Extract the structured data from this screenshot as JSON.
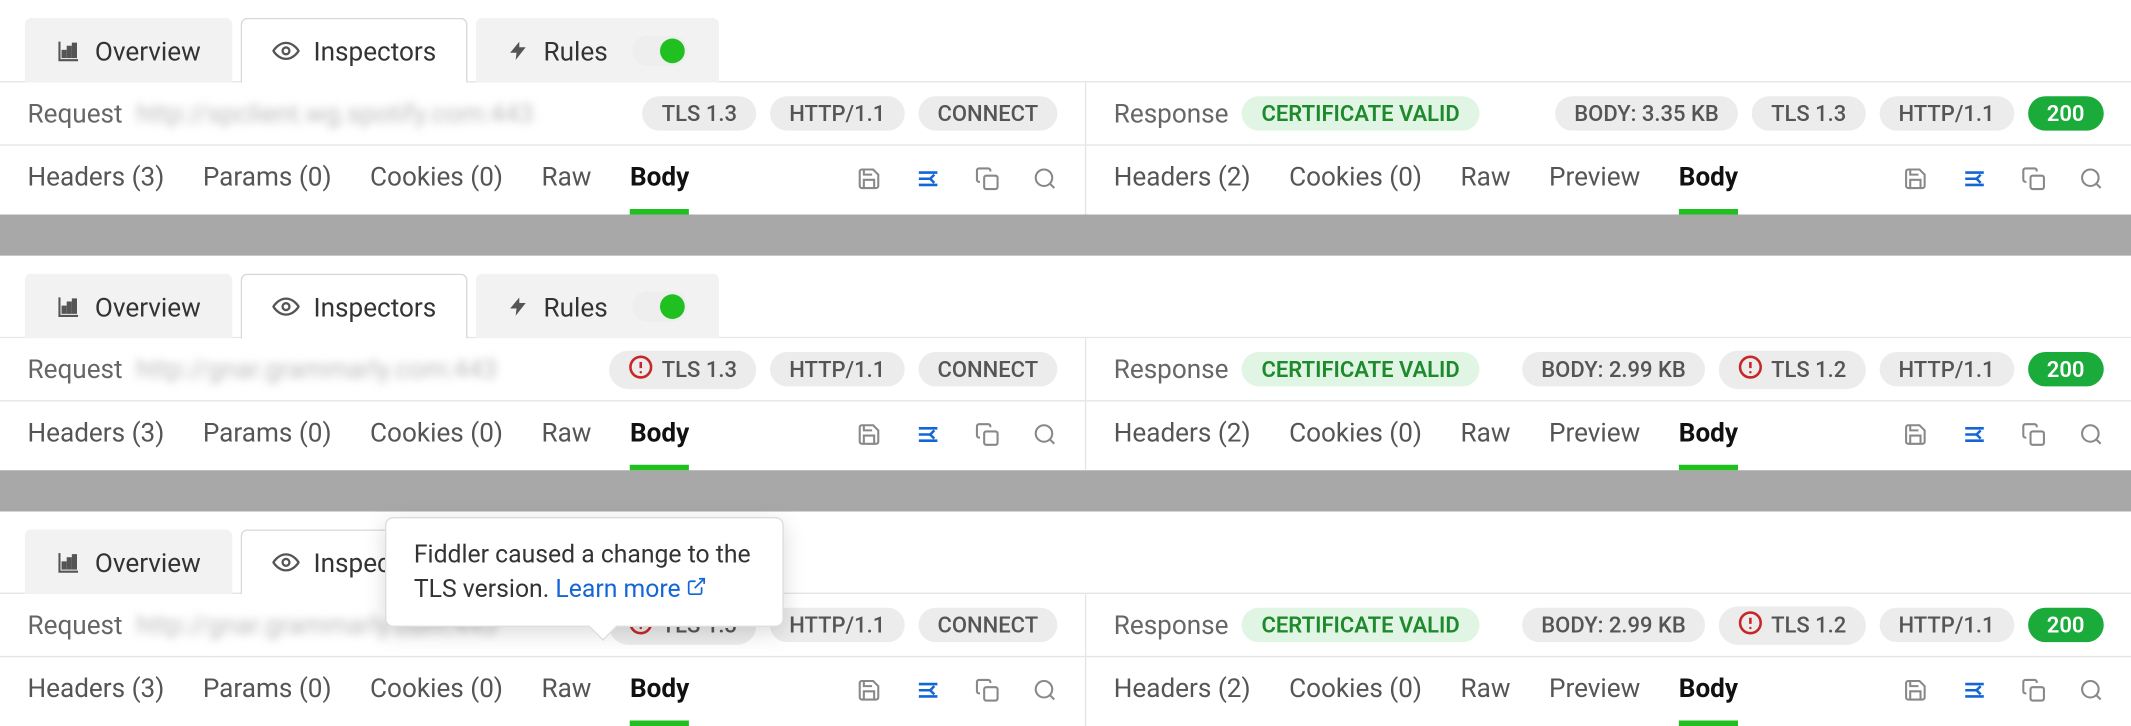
{
  "tabs": {
    "overview": "Overview",
    "inspectors": "Inspectors",
    "rules": "Rules"
  },
  "panels": [
    {
      "request": {
        "label": "Request",
        "host": "http://spclient.wg.spotify.com:443",
        "pills": [
          {
            "text": "TLS 1.3",
            "warn": false
          },
          {
            "text": "HTTP/1.1"
          },
          {
            "text": "CONNECT"
          }
        ],
        "subtabs": [
          {
            "label": "Headers",
            "count": 3
          },
          {
            "label": "Params",
            "count": 0
          },
          {
            "label": "Cookies",
            "count": 0
          },
          {
            "label_only": "Raw"
          },
          {
            "label_only": "Body",
            "active": true
          }
        ]
      },
      "response": {
        "label": "Response",
        "cert": "CERTIFICATE VALID",
        "pills": [
          {
            "text": "BODY: 3.35 KB"
          },
          {
            "text": "TLS 1.3",
            "warn": false
          },
          {
            "text": "HTTP/1.1"
          }
        ],
        "status": "200",
        "subtabs": [
          {
            "label": "Headers",
            "count": 2
          },
          {
            "label": "Cookies",
            "count": 0
          },
          {
            "label_only": "Raw"
          },
          {
            "label_only": "Preview"
          },
          {
            "label_only": "Body",
            "active": true
          }
        ]
      }
    },
    {
      "request": {
        "label": "Request",
        "host": "http://gnar.grammarly.com:443",
        "pills": [
          {
            "text": "TLS 1.3",
            "warn": true
          },
          {
            "text": "HTTP/1.1"
          },
          {
            "text": "CONNECT"
          }
        ],
        "subtabs": [
          {
            "label": "Headers",
            "count": 3
          },
          {
            "label": "Params",
            "count": 0
          },
          {
            "label": "Cookies",
            "count": 0
          },
          {
            "label_only": "Raw"
          },
          {
            "label_only": "Body",
            "active": true
          }
        ]
      },
      "response": {
        "label": "Response",
        "cert": "CERTIFICATE VALID",
        "pills": [
          {
            "text": "BODY: 2.99 KB"
          },
          {
            "text": "TLS 1.2",
            "warn": true
          },
          {
            "text": "HTTP/1.1"
          }
        ],
        "status": "200",
        "subtabs": [
          {
            "label": "Headers",
            "count": 2
          },
          {
            "label": "Cookies",
            "count": 0
          },
          {
            "label_only": "Raw"
          },
          {
            "label_only": "Preview"
          },
          {
            "label_only": "Body",
            "active": true
          }
        ]
      }
    },
    {
      "tooltip": {
        "text": "Fiddler caused a change to the TLS version.",
        "link": "Learn more"
      },
      "request": {
        "label": "Request",
        "host": "http://gnar.grammarly.com:443",
        "pills": [
          {
            "text": "TLS 1.3",
            "warn": true
          },
          {
            "text": "HTTP/1.1"
          },
          {
            "text": "CONNECT"
          }
        ],
        "subtabs": [
          {
            "label": "Headers",
            "count": 3
          },
          {
            "label": "Params",
            "count": 0
          },
          {
            "label": "Cookies",
            "count": 0
          },
          {
            "label_only": "Raw"
          },
          {
            "label_only": "Body",
            "active": true
          }
        ]
      },
      "response": {
        "label": "Response",
        "cert": "CERTIFICATE VALID",
        "pills": [
          {
            "text": "BODY: 2.99 KB"
          },
          {
            "text": "TLS 1.2",
            "warn": true
          },
          {
            "text": "HTTP/1.1"
          }
        ],
        "status": "200",
        "subtabs": [
          {
            "label": "Headers",
            "count": 2
          },
          {
            "label": "Cookies",
            "count": 0
          },
          {
            "label_only": "Raw"
          },
          {
            "label_only": "Preview"
          },
          {
            "label_only": "Body",
            "active": true
          }
        ]
      }
    }
  ],
  "icons": {
    "save": "save-icon",
    "format": "format-icon",
    "copy": "copy-icon",
    "search": "search-icon"
  }
}
